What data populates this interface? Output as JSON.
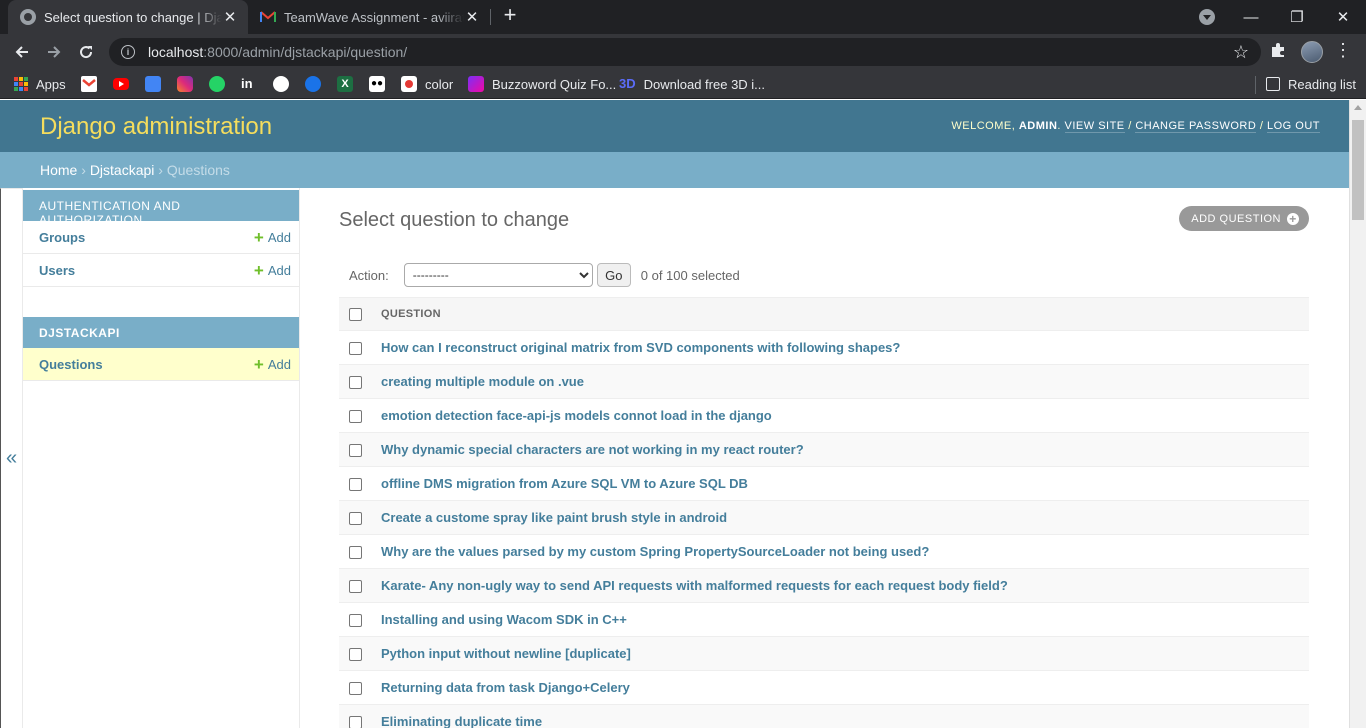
{
  "browser": {
    "tabs": [
      {
        "title": "Select question to change | Django site admin",
        "active": true
      },
      {
        "title": "TeamWave Assignment - aviiratha",
        "active": false
      }
    ],
    "url_host": "localhost",
    "url_rest": ":8000/admin/djstackapi/question/",
    "bookmarks": [
      {
        "label": "Apps",
        "icon": "apps-grid-icon"
      },
      {
        "label": "",
        "icon": "gmail-icon"
      },
      {
        "label": "",
        "icon": "youtube-icon"
      },
      {
        "label": "",
        "icon": "translate-icon"
      },
      {
        "label": "",
        "icon": "instagram-icon"
      },
      {
        "label": "",
        "icon": "whatsapp-icon"
      },
      {
        "label": "",
        "icon": "linkedin-icon"
      },
      {
        "label": "",
        "icon": "github-icon"
      },
      {
        "label": "",
        "icon": "robot-icon"
      },
      {
        "label": "",
        "icon": "excel-icon"
      },
      {
        "label": "",
        "icon": "medium-icon"
      },
      {
        "label": "color",
        "icon": "color-icon"
      },
      {
        "label": "Buzzoword Quiz Fo...",
        "icon": "buzzoword-icon"
      },
      {
        "label": "Download free 3D i...",
        "icon": "3d-icon"
      }
    ],
    "reading_list": "Reading list",
    "threed_text": "3D"
  },
  "header": {
    "branding": "Django administration",
    "welcome": "Welcome,",
    "user": "admin",
    "view_site": "View site",
    "change_password": "Change password",
    "log_out": "Log out"
  },
  "breadcrumbs": {
    "home": "Home",
    "app": "Djstackapi",
    "current": "Questions"
  },
  "sidebar": {
    "modules": [
      {
        "caption": "Authentication and Authorization",
        "rows": [
          {
            "name": "Groups",
            "add": "Add"
          },
          {
            "name": "Users",
            "add": "Add"
          }
        ]
      },
      {
        "caption": "Djstackapi",
        "rows": [
          {
            "name": "Questions",
            "add": "Add"
          }
        ]
      }
    ],
    "collapse_glyph": "«"
  },
  "content": {
    "title": "Select question to change",
    "add_button": "Add question",
    "action_label": "Action:",
    "action_selected": "---------",
    "go": "Go",
    "selected_count": "0 of 100 selected",
    "column_header": "Question",
    "questions": [
      "How can I reconstruct original matrix from SVD components with following shapes?",
      "creating multiple module on .vue",
      "emotion detection face-api-js models connot load in the django",
      "Why dynamic special characters are not working in my react router?",
      "offline DMS migration from Azure SQL VM to Azure SQL DB",
      "Create a custome spray like paint brush style in android",
      "Why are the values parsed by my custom Spring PropertySourceLoader not being used?",
      "Karate- Any non-ugly way to send API requests with malformed requests for each request body field?",
      "Installing and using Wacom SDK in C++",
      "Python input without newline [duplicate]",
      "Returning data from task Django+Celery",
      "Eliminating duplicate time"
    ]
  },
  "colors": {
    "header_bg": "#417690",
    "breadcrumb_bg": "#79aec8",
    "branding": "#f5dd5d",
    "link": "#447e9b",
    "current_row": "#ffffcc",
    "add_green": "#70bf2b"
  }
}
